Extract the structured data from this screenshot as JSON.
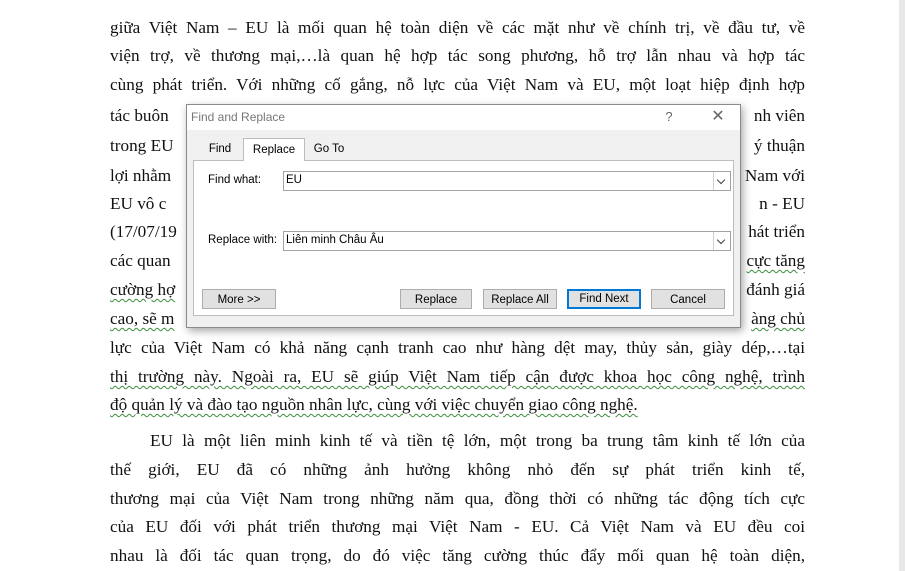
{
  "document": {
    "lines": [
      "giữa Việt Nam – EU là mối quan hệ toàn diện về các mặt như về chính trị, về đầu tư, về",
      "viện trợ, về thương mại,…là quan hệ hợp tác song phương, hỗ trợ lẫn nhau và hợp tác",
      "cùng phát triển. Với những cố gắng, nỗ lực của Việt Nam và EU, một loạt hiệp định hợp",
      "lực của Việt Nam có khả năng cạnh tranh cao như hàng dệt may, thủy sản, giày dép,…tại",
      "thị trường này. Ngoài ra, EU sẽ giúp Việt Nam tiếp cận được khoa học công nghệ, trình",
      "độ quản lý và đào tạo nguồn nhân lực, cùng với việc chuyển giao công nghệ.",
      "EU là một liên minh kinh tế và tiền tệ lớn, một trong ba trung tâm kinh tế lớn của",
      "thế giới, EU đã có những ảnh hưởng không nhỏ đến sự phát triển kinh tế,",
      "thương mại của Việt Nam trong những năm qua, đồng thời có những tác động tích cực",
      "của EU đối với phát triển thương mại Việt Nam - EU. Cả Việt Nam và EU đều coi",
      "nhau là đối tác quan trọng, do đó việc tăng cường thúc đẩy mối quan hệ toàn diện,"
    ],
    "left_fragments": [
      "tác buôn",
      "trong EU",
      "lợi nhằm",
      "EU vô c",
      "(17/07/19",
      "các quan",
      "cường hợ",
      "cao, sẽ m"
    ],
    "right_fragments": [
      "nh viên",
      "ý thuận",
      "Nam với",
      "n - EU",
      "hát triển",
      "cực tăng",
      "đánh giá",
      "àng chủ"
    ]
  },
  "dialog": {
    "title": "Find and Replace",
    "help": "?",
    "close": "✕",
    "tabs": {
      "find": "Find",
      "replace": "Replace",
      "goto": "Go To"
    },
    "find_label": "Find what:",
    "find_value": "EU",
    "replace_label": "Replace with:",
    "replace_value": "Liên minh Châu Âu",
    "buttons": {
      "more": "More >>",
      "replace": "Replace",
      "replace_all": "Replace All",
      "find_next": "Find Next",
      "cancel": "Cancel"
    }
  }
}
